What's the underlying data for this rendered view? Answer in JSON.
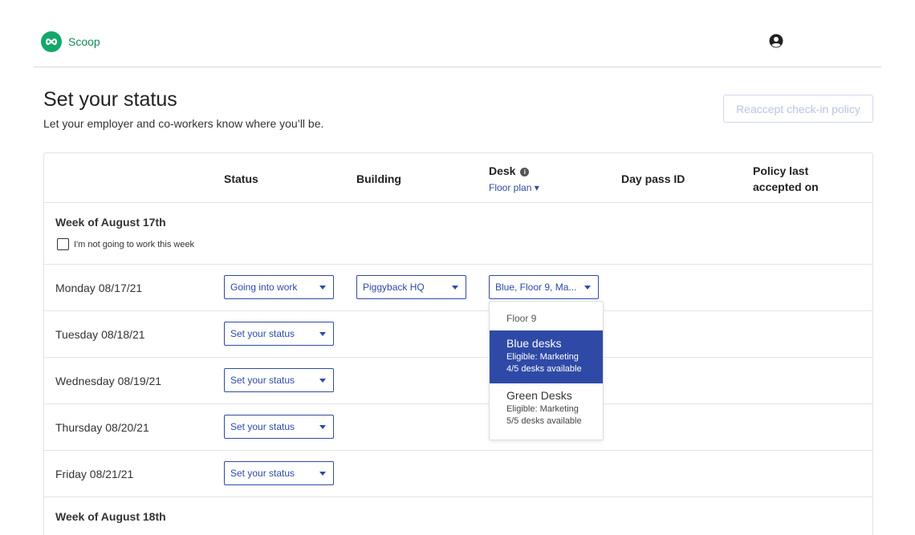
{
  "app": {
    "name": "Scoop",
    "brand_color": "#13a86a",
    "accent_color": "#2f4aa6"
  },
  "header": {
    "account_icon": "user-circle-icon"
  },
  "page": {
    "title": "Set your status",
    "subtitle": "Let your employer and co-workers know where you’ll be.",
    "reaccept_label": "Reaccept check-in policy"
  },
  "table": {
    "columns": {
      "status": "Status",
      "building": "Building",
      "desk": "Desk",
      "floor_plan": "Floor plan",
      "day_pass": "Day pass ID",
      "policy_line1": "Policy last",
      "policy_line2": "accepted on"
    },
    "week1": {
      "title": "Week of August 17th",
      "skip_label": "I'm not going to work this week"
    },
    "days": [
      {
        "label": "Monday 08/17/21",
        "status": "Going into work",
        "building": "Piggyback HQ",
        "desk": "Blue, Floor 9, Ma..."
      },
      {
        "label": "Tuesday 08/18/21",
        "status": "Set your status"
      },
      {
        "label": "Wednesday 08/19/21",
        "status": "Set your status"
      },
      {
        "label": "Thursday 08/20/21",
        "status": "Set your status"
      },
      {
        "label": "Friday 08/21/21",
        "status": "Set your status"
      }
    ],
    "week2": {
      "title": "Week of August 18th"
    }
  },
  "desk_dropdown": {
    "group": "Floor 9",
    "options": [
      {
        "name": "Blue desks",
        "eligible": "Eligible: Marketing",
        "availability": "4/5 desks available",
        "selected": true
      },
      {
        "name": "Green Desks",
        "eligible": "Eligible: Marketing",
        "availability": "5/5 desks available",
        "selected": false
      }
    ]
  }
}
